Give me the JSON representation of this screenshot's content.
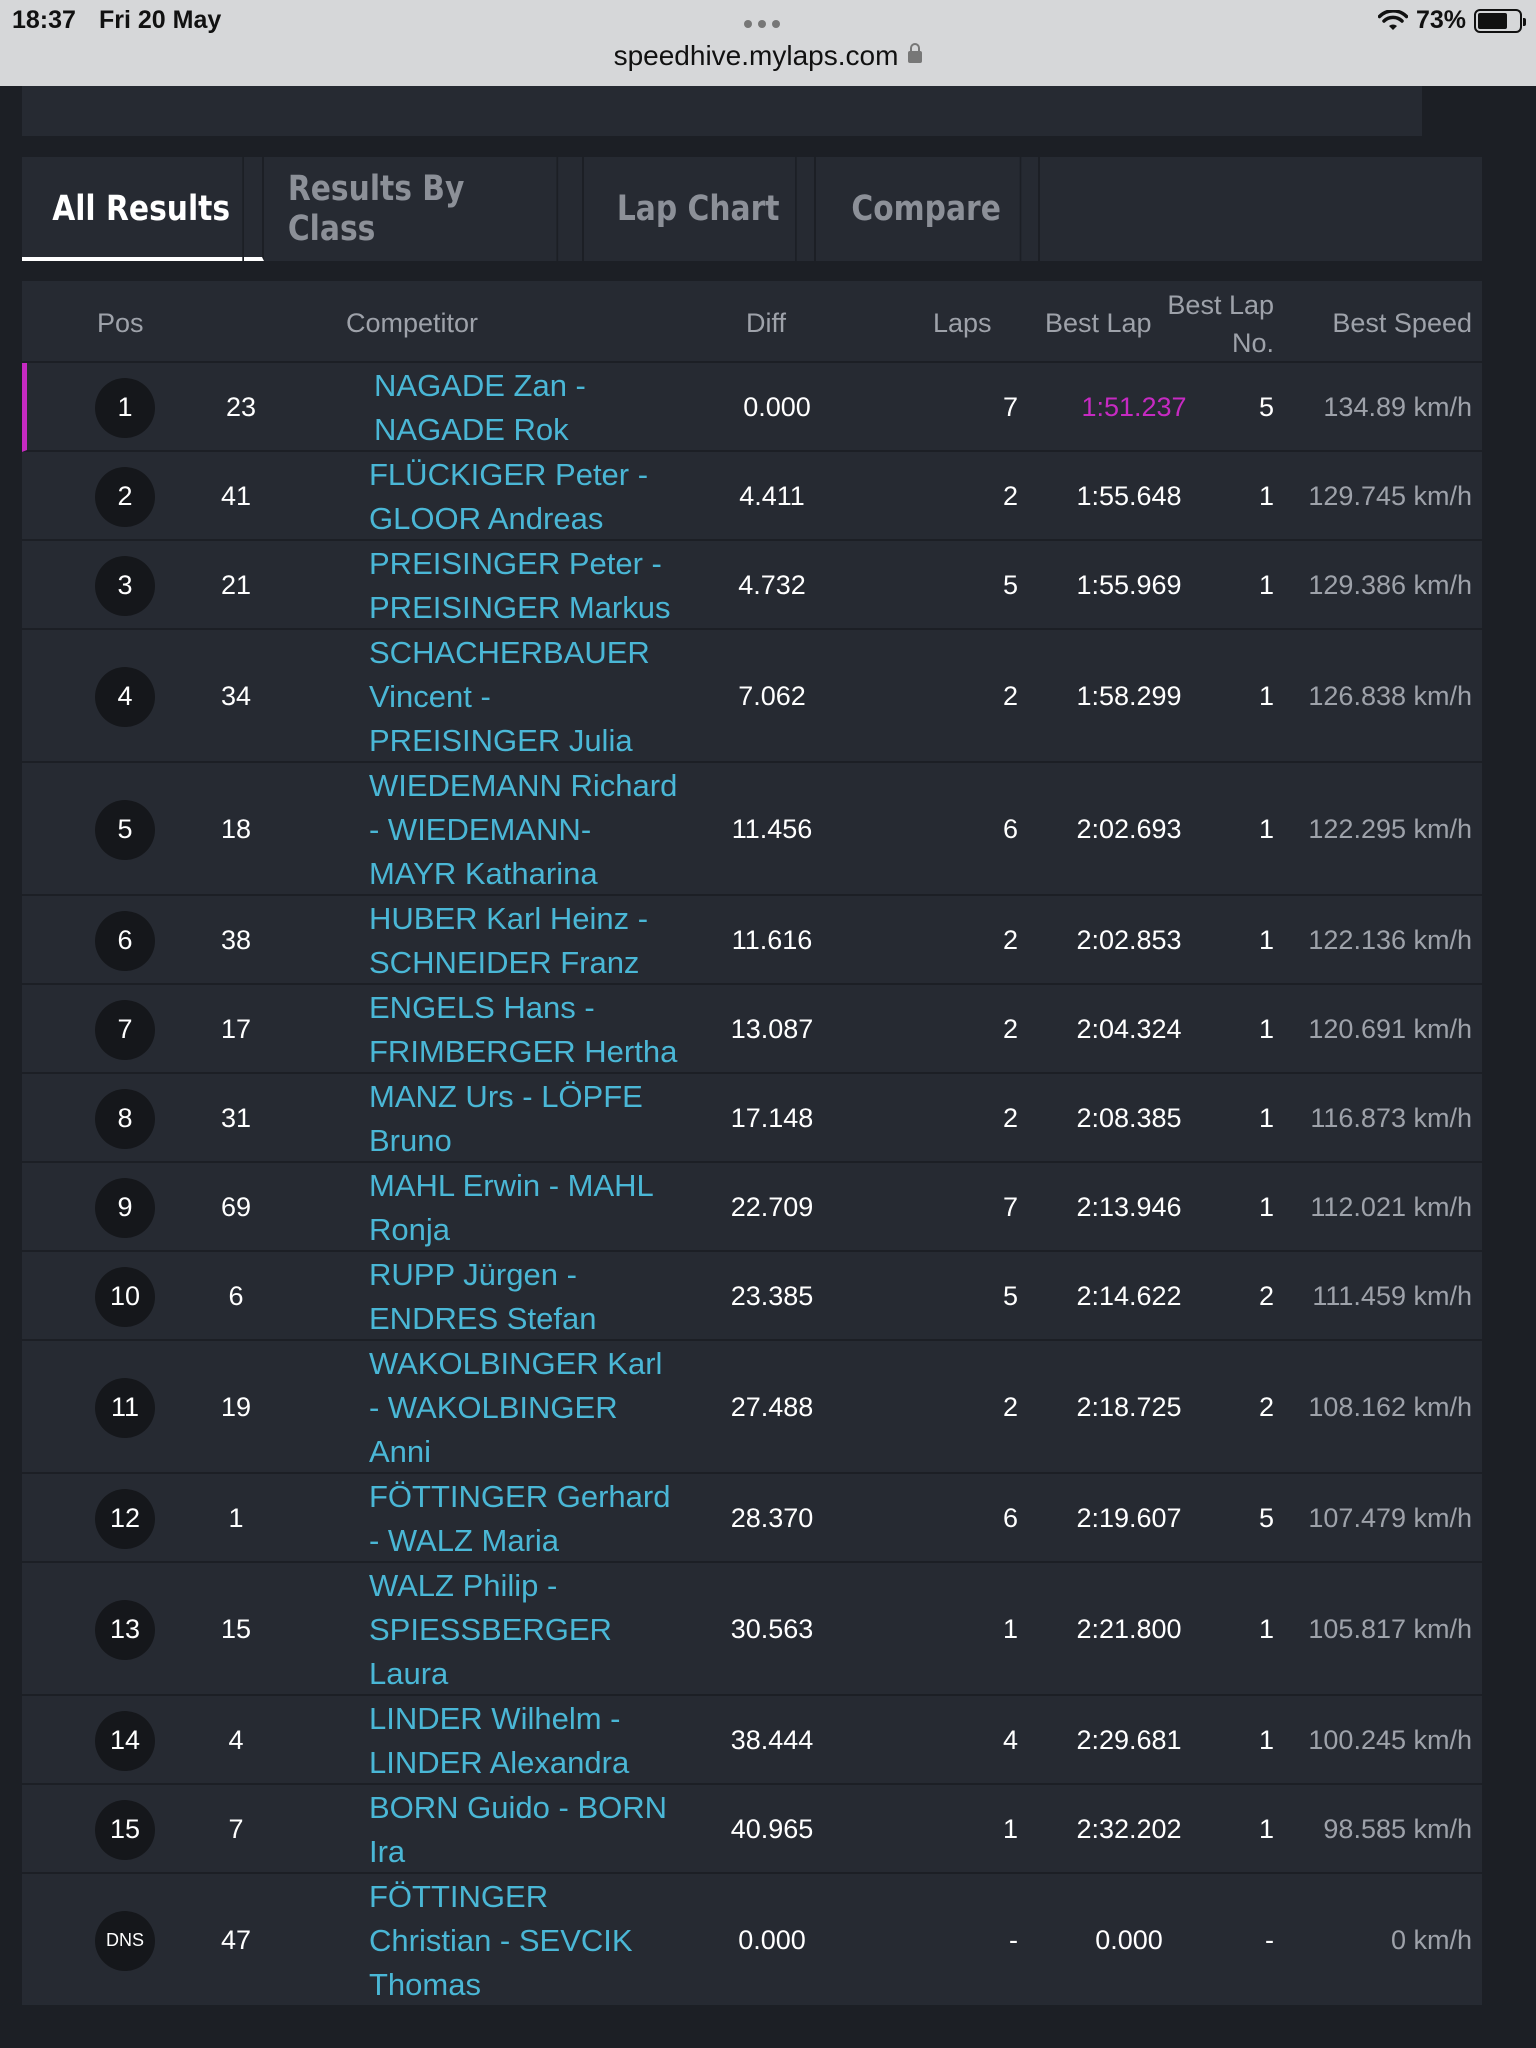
{
  "status": {
    "time": "18:37",
    "date": "Fri 20 May",
    "battery": "73%",
    "battery_level": 0.73,
    "url": "speedhive.mylaps.com"
  },
  "tabs": [
    {
      "label": "All Results",
      "active": true
    },
    {
      "label": "Results By Class",
      "active": false
    },
    {
      "label": "Lap Chart",
      "active": false
    },
    {
      "label": "Compare",
      "active": false
    }
  ],
  "headers": {
    "pos": "Pos",
    "competitor": "Competitor",
    "diff": "Diff",
    "laps": "Laps",
    "best_lap": "Best Lap",
    "best_lap_no_1": "Best Lap",
    "best_lap_no_2": "No.",
    "best_speed": "Best Speed"
  },
  "rows": [
    {
      "pos": "1",
      "num": "23",
      "competitor": "NAGADE Zan - NAGADE Rok",
      "lines": [
        "NAGADE Zan -",
        "NAGADE Rok"
      ],
      "diff": "0.000",
      "laps": "7",
      "best_lap": "1:51.237",
      "lap_no": "5",
      "speed": "134.89 km/h",
      "leader": true
    },
    {
      "pos": "2",
      "num": "41",
      "lines": [
        "FLÜCKIGER Peter -",
        "GLOOR Andreas"
      ],
      "diff": "4.411",
      "laps": "2",
      "best_lap": "1:55.648",
      "lap_no": "1",
      "speed": "129.745 km/h"
    },
    {
      "pos": "3",
      "num": "21",
      "lines": [
        "PREISINGER Peter -",
        "PREISINGER Markus"
      ],
      "diff": "4.732",
      "laps": "5",
      "best_lap": "1:55.969",
      "lap_no": "1",
      "speed": "129.386 km/h"
    },
    {
      "pos": "4",
      "num": "34",
      "lines": [
        "SCHACHERBAUER",
        "Vincent -",
        "PREISINGER Julia"
      ],
      "diff": "7.062",
      "laps": "2",
      "best_lap": "1:58.299",
      "lap_no": "1",
      "speed": "126.838 km/h"
    },
    {
      "pos": "5",
      "num": "18",
      "lines": [
        "WIEDEMANN Richard",
        "- WIEDEMANN-",
        "MAYR Katharina"
      ],
      "diff": "11.456",
      "laps": "6",
      "best_lap": "2:02.693",
      "lap_no": "1",
      "speed": "122.295 km/h"
    },
    {
      "pos": "6",
      "num": "38",
      "lines": [
        "HUBER Karl Heinz -",
        "SCHNEIDER Franz"
      ],
      "diff": "11.616",
      "laps": "2",
      "best_lap": "2:02.853",
      "lap_no": "1",
      "speed": "122.136 km/h"
    },
    {
      "pos": "7",
      "num": "17",
      "lines": [
        "ENGELS Hans -",
        "FRIMBERGER Hertha"
      ],
      "diff": "13.087",
      "laps": "2",
      "best_lap": "2:04.324",
      "lap_no": "1",
      "speed": "120.691 km/h"
    },
    {
      "pos": "8",
      "num": "31",
      "lines": [
        "MANZ Urs - LÖPFE",
        "Bruno"
      ],
      "diff": "17.148",
      "laps": "2",
      "best_lap": "2:08.385",
      "lap_no": "1",
      "speed": "116.873 km/h"
    },
    {
      "pos": "9",
      "num": "69",
      "lines": [
        "MAHL Erwin - MAHL",
        "Ronja"
      ],
      "diff": "22.709",
      "laps": "7",
      "best_lap": "2:13.946",
      "lap_no": "1",
      "speed": "112.021 km/h"
    },
    {
      "pos": "10",
      "num": "6",
      "lines": [
        "RUPP Jürgen -",
        "ENDRES Stefan"
      ],
      "diff": "23.385",
      "laps": "5",
      "best_lap": "2:14.622",
      "lap_no": "2",
      "speed": "111.459 km/h"
    },
    {
      "pos": "11",
      "num": "19",
      "lines": [
        "WAKOLBINGER Karl",
        "- WAKOLBINGER",
        "Anni"
      ],
      "diff": "27.488",
      "laps": "2",
      "best_lap": "2:18.725",
      "lap_no": "2",
      "speed": "108.162 km/h"
    },
    {
      "pos": "12",
      "num": "1",
      "lines": [
        "FÖTTINGER Gerhard",
        "- WALZ Maria"
      ],
      "diff": "28.370",
      "laps": "6",
      "best_lap": "2:19.607",
      "lap_no": "5",
      "speed": "107.479 km/h"
    },
    {
      "pos": "13",
      "num": "15",
      "lines": [
        "WALZ Philip -",
        "SPIESSBERGER",
        "Laura"
      ],
      "diff": "30.563",
      "laps": "1",
      "best_lap": "2:21.800",
      "lap_no": "1",
      "speed": "105.817 km/h"
    },
    {
      "pos": "14",
      "num": "4",
      "lines": [
        "LINDER Wilhelm -",
        "LINDER Alexandra"
      ],
      "diff": "38.444",
      "laps": "4",
      "best_lap": "2:29.681",
      "lap_no": "1",
      "speed": "100.245 km/h"
    },
    {
      "pos": "15",
      "num": "7",
      "lines": [
        "BORN Guido - BORN",
        "Ira"
      ],
      "diff": "40.965",
      "laps": "1",
      "best_lap": "2:32.202",
      "lap_no": "1",
      "speed": "98.585 km/h"
    },
    {
      "pos": "DNS",
      "num": "47",
      "lines": [
        "FÖTTINGER",
        "Christian - SEVCIK",
        "Thomas"
      ],
      "diff": "0.000",
      "laps": "-",
      "best_lap": "0.000",
      "lap_no": "-",
      "speed": "0 km/h"
    }
  ],
  "colors": {
    "background": "#1c1f25",
    "panel": "#262a32",
    "competitor_link": "#4ab7d6",
    "fastest_lap": "#c62ac2"
  }
}
